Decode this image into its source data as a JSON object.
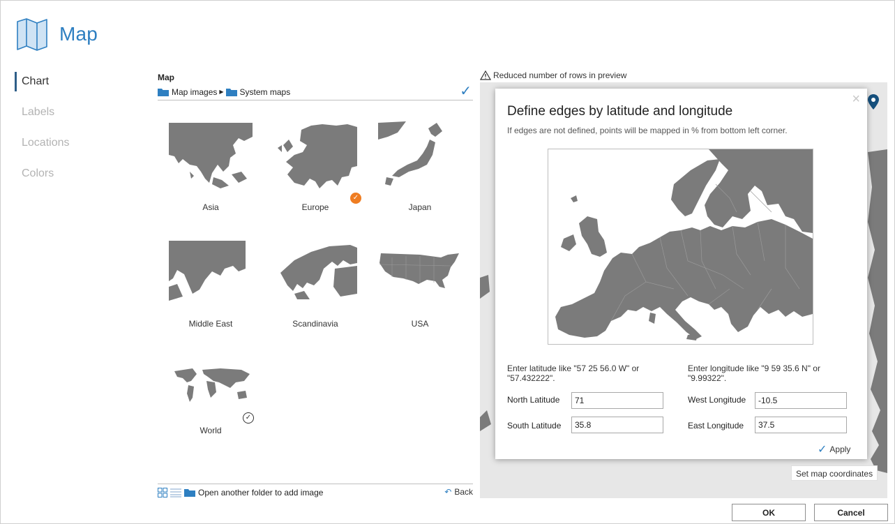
{
  "header": {
    "title": "Map"
  },
  "nav": {
    "items": [
      {
        "label": "Chart",
        "active": true
      },
      {
        "label": "Labels",
        "active": false
      },
      {
        "label": "Locations",
        "active": false
      },
      {
        "label": "Colors",
        "active": false
      }
    ]
  },
  "picker": {
    "title": "Map",
    "breadcrumb": [
      "Map images",
      "System maps"
    ],
    "tiles": [
      {
        "label": "Asia",
        "selected": false
      },
      {
        "label": "Europe",
        "selected": true
      },
      {
        "label": "Japan",
        "selected": false
      },
      {
        "label": "Middle East",
        "selected": false
      },
      {
        "label": "Scandinavia",
        "selected": false
      },
      {
        "label": "USA",
        "selected": false
      },
      {
        "label": "World",
        "selected": false,
        "marked": true
      }
    ],
    "footer": {
      "open_folder": "Open another folder to add image",
      "back": "Back"
    }
  },
  "preview": {
    "warning": "Reduced number of rows in preview",
    "set_coords": "Set map coordinates"
  },
  "dialog": {
    "title": "Define edges by latitude and longitude",
    "subtitle": "If edges are not defined, points will be mapped in % from bottom left corner.",
    "lat_hint": "Enter latitude like \"57 25 56.0 W\" or \"57.432222\".",
    "lon_hint": "Enter longitude like \"9 59 35.6 N\" or \"9.99322\".",
    "north_label": "North Latitude",
    "north_value": "71",
    "south_label": "South Latitude",
    "south_value": "35.8",
    "west_label": "West Longitude",
    "west_value": "-10.5",
    "east_label": "East Longitude",
    "east_value": "37.5",
    "apply": "Apply",
    "close": "×"
  },
  "buttons": {
    "ok": "OK",
    "cancel": "Cancel"
  },
  "colors": {
    "accent": "#2e7fc1",
    "selected_badge": "#ef7d22",
    "map_fill": "#7b7b7b"
  }
}
